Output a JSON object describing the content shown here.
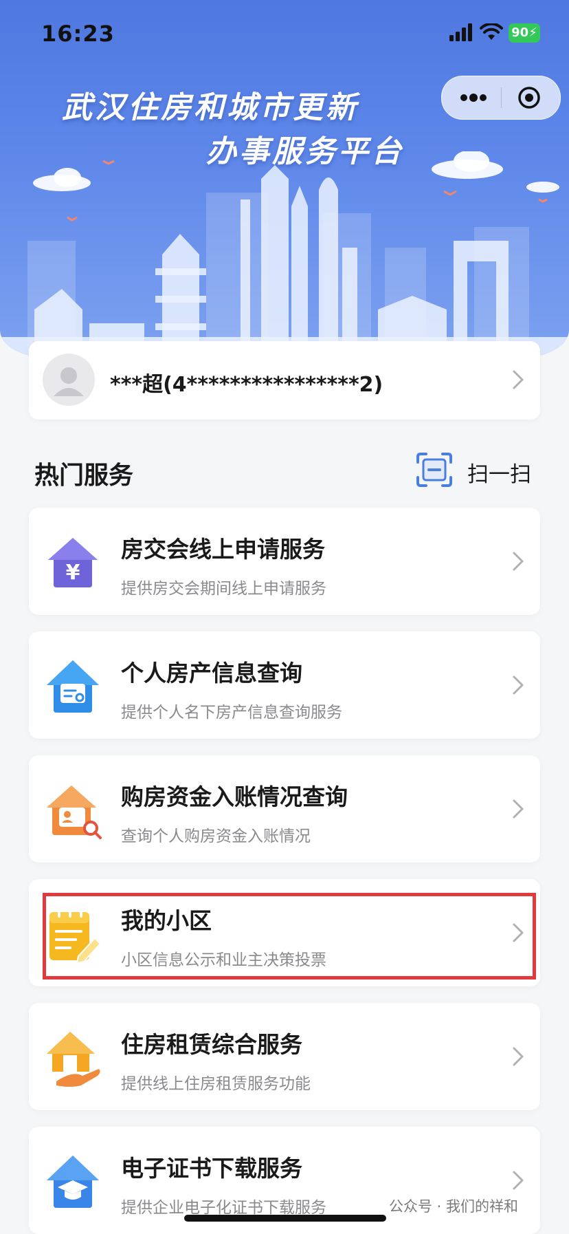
{
  "status_bar": {
    "time": "16:23",
    "battery": "90"
  },
  "header": {
    "title_line1": "武汉住房和城市更新",
    "title_line2": "办事服务平台"
  },
  "user": {
    "name": "***超(4****************2)"
  },
  "hot_services": {
    "title": "热门服务",
    "scan_label": "扫一扫"
  },
  "services": [
    {
      "title": "房交会线上申请服务",
      "desc": "提供房交会期间线上申请服务",
      "icon": "yuan-house-icon"
    },
    {
      "title": "个人房产信息查询",
      "desc": "提供个人名下房产信息查询服务",
      "icon": "house-search-icon"
    },
    {
      "title": "购房资金入账情况查询",
      "desc": "查询个人购房资金入账情况",
      "icon": "fund-search-icon"
    },
    {
      "title": "我的小区",
      "desc": "小区信息公示和业主决策投票",
      "icon": "notepad-pen-icon"
    },
    {
      "title": "住房租赁综合服务",
      "desc": "提供线上住房租赁服务功能",
      "icon": "house-hand-icon"
    },
    {
      "title": "电子证书下载服务",
      "desc": "提供企业电子化证书下载服务",
      "icon": "graduation-house-icon"
    }
  ],
  "watermark": {
    "text": "公众号 · 我们的祥和"
  },
  "colors": {
    "header": "#5f88ea",
    "highlight": "#e0393e",
    "accent_blue": "#4a7fe0"
  }
}
